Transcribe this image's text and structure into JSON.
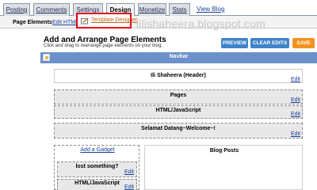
{
  "tabs": [
    {
      "label": "Posting"
    },
    {
      "label": "Comments"
    },
    {
      "label": "Settings"
    },
    {
      "label": "Design"
    },
    {
      "label": "Monetize"
    },
    {
      "label": "Stats"
    }
  ],
  "view_blog": "View Blog",
  "subtabs": {
    "page_elements": "Page Elements",
    "edit_html": "Edit HTML",
    "template_designer": "Template Designer"
  },
  "watermark": "lilishaheera.blogspot.com",
  "main": {
    "heading": "Add and Arrange Page Elements",
    "subheading": "Click and drag to rearrange page elements on your blog.",
    "buttons": {
      "preview": "PREVIEW",
      "clear_edits": "CLEAR EDITS",
      "save": "SAVE"
    }
  },
  "navbar": {
    "title": "Navbar"
  },
  "widgets": {
    "header": {
      "title": "Ili Shaheera (Header)",
      "edit": "Edit"
    },
    "pages": {
      "title": "Pages",
      "edit": "Edit"
    },
    "html1": {
      "title": "HTML/JavaScript",
      "edit": "Edit"
    },
    "greeting": {
      "title": "Selamat Datang~Welcome~!",
      "edit": "Edit"
    },
    "add_gadget": "Add a Gadget",
    "lost": {
      "title": "lost something?",
      "edit": "Edit"
    },
    "html2": {
      "title": "HTML/JavaScript",
      "edit": "Edit"
    },
    "blog_posts": {
      "title": "Blog Posts"
    }
  },
  "colors": {
    "navbar_blue": "#6b91c8",
    "button_blue": "#3f83c9",
    "save_orange": "#f29321",
    "highlight_red": "#e0001b"
  }
}
